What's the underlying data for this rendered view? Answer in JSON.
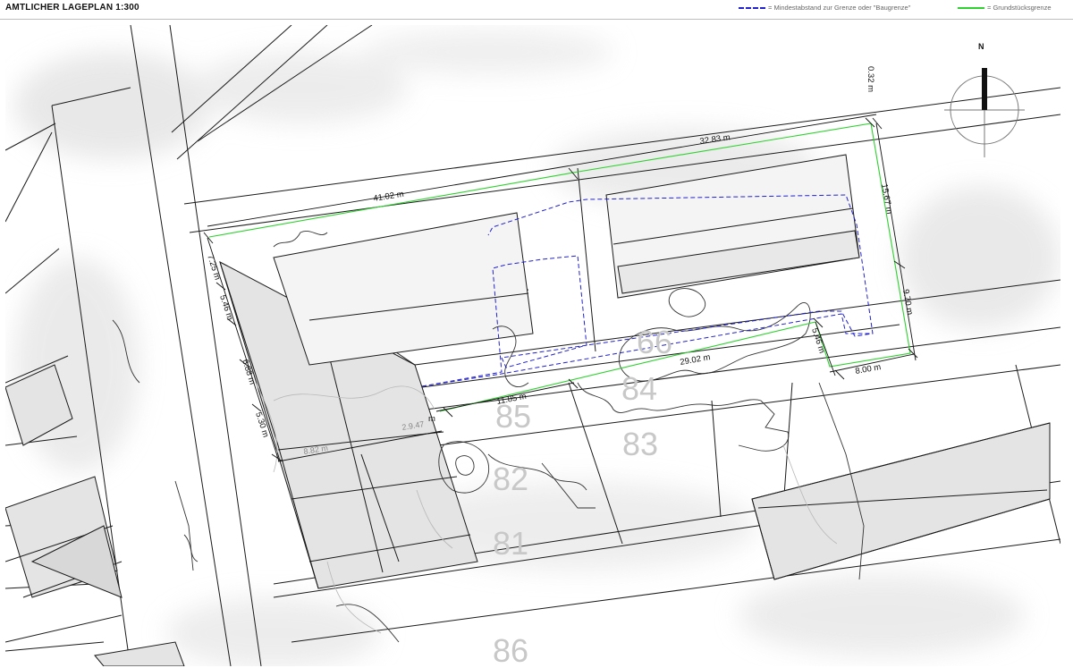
{
  "header": {
    "title": "AMTLICHER LAGEPLAN 1:300",
    "legend": [
      {
        "label": "= Mindestabstand zur Grenze oder \"Baugrenze\"",
        "color": "#2222cc",
        "style": "dashed"
      },
      {
        "label": "= Grundstücksgrenze",
        "color": "#2ed12e",
        "style": "solid"
      }
    ]
  },
  "compass": {
    "label": "N"
  },
  "dimensions": {
    "top_right_offset": "0.32 m",
    "top_right": "32.83 m",
    "top_left": "41.02 m",
    "right_upper": "15.67 m",
    "right_lower": "9.70 m",
    "left_1": "7.25 m",
    "left_2": "5.46 m",
    "left_3": "6.88 m",
    "left_4": "5.30 m",
    "inner_left": "5.46 m",
    "bottom_right": "8.00 m",
    "bottom_middle": "29.02 m",
    "bottom_left": "11.85 m",
    "grey_1": "8.82 m",
    "grey_2": "2.9.47",
    "stray_m": "m"
  },
  "parcels": [
    "66",
    "84",
    "85",
    "83",
    "82",
    "81",
    "86"
  ],
  "colors": {
    "boundary": "#2ed12e",
    "setback": "#2222cc",
    "lines": "#1a1a1a",
    "building_fill": "#e4e4e4"
  }
}
